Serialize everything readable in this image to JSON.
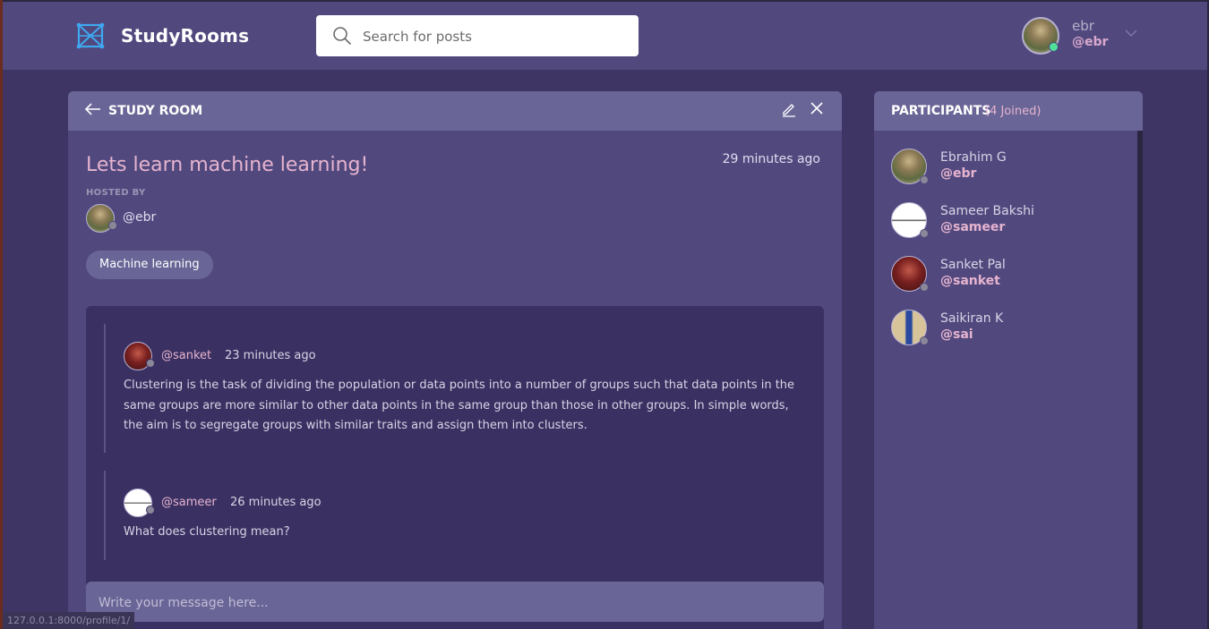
{
  "app": {
    "name": "StudyRooms"
  },
  "search": {
    "placeholder": "Search for posts"
  },
  "user": {
    "name": "ebr",
    "handle": "@ebr"
  },
  "room": {
    "header_title": "STUDY ROOM",
    "title": "Lets learn machine learning!",
    "time": "29 minutes ago",
    "hosted_by_label": "HOSTED BY",
    "host_handle": "@ebr",
    "topic": "Machine learning",
    "messages": [
      {
        "handle": "@sanket",
        "time": "23 minutes ago",
        "body": "Clustering is the task of dividing the population or data points into a number of groups such that data points in the same groups are more similar to other data points in the same group than those in other groups. In simple words, the aim is to segregate groups with similar traits and assign them into clusters."
      },
      {
        "handle": "@sameer",
        "time": "26 minutes ago",
        "body": "What does clustering mean?"
      }
    ],
    "message_placeholder": "Write your message here..."
  },
  "participants": {
    "title": "PARTICIPANTS",
    "count_label": "(4 Joined)",
    "items": [
      {
        "name": "Ebrahim G",
        "handle": "@ebr"
      },
      {
        "name": "Sameer Bakshi",
        "handle": "@sameer"
      },
      {
        "name": "Sanket Pal",
        "handle": "@sanket"
      },
      {
        "name": "Saikiran K",
        "handle": "@sai"
      }
    ]
  },
  "status_bar": {
    "url": "127.0.0.1:8000/profile/1/"
  },
  "colors": {
    "background": "#3f3564",
    "header": "#51497e",
    "card_header": "#696596",
    "accent_pink": "#e6b4cf",
    "online": "#4fe09a"
  }
}
